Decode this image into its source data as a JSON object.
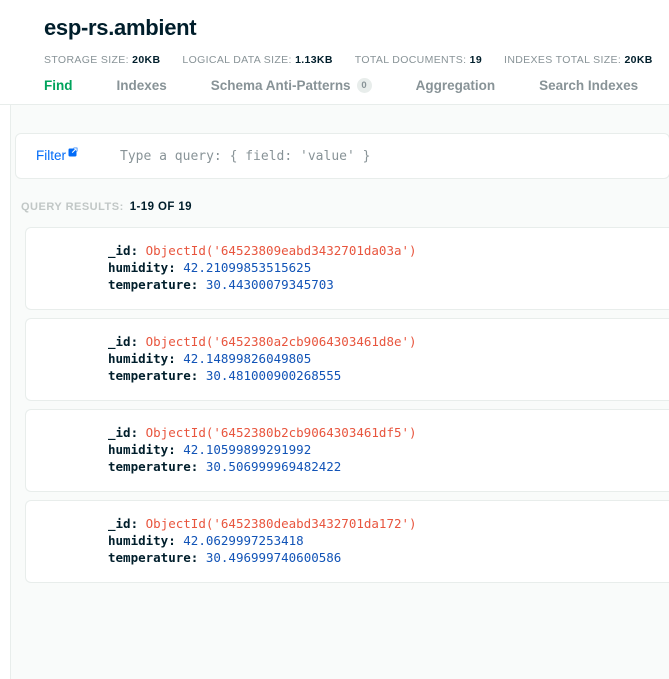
{
  "header": {
    "collection_title": "esp-rs.ambient",
    "stats": [
      {
        "label": "STORAGE SIZE:",
        "value": "20KB"
      },
      {
        "label": "LOGICAL DATA SIZE:",
        "value": "1.13KB"
      },
      {
        "label": "TOTAL DOCUMENTS:",
        "value": "19"
      },
      {
        "label": "INDEXES TOTAL SIZE:",
        "value": "20KB"
      }
    ]
  },
  "tabs": [
    {
      "label": "Find",
      "active": true,
      "badge": null
    },
    {
      "label": "Indexes",
      "active": false,
      "badge": null
    },
    {
      "label": "Schema Anti-Patterns",
      "active": false,
      "badge": "0"
    },
    {
      "label": "Aggregation",
      "active": false,
      "badge": null
    },
    {
      "label": "Search Indexes",
      "active": false,
      "badge": null
    }
  ],
  "query_bar": {
    "filter_label": "Filter",
    "filter_icon": "external-link-icon",
    "query_value": "",
    "query_placeholder": "Type a query: { field: 'value' }"
  },
  "results": {
    "label": "QUERY RESULTS:",
    "count": "1-19 OF 19"
  },
  "documents": [
    {
      "id_key": "_id",
      "id_value": "ObjectId('64523809eabd3432701da03a')",
      "humidity_key": "humidity",
      "humidity_value": "42.21099853515625",
      "temperature_key": "temperature",
      "temperature_value": "30.44300079345703"
    },
    {
      "id_key": "_id",
      "id_value": "ObjectId('6452380a2cb9064303461d8e')",
      "humidity_key": "humidity",
      "humidity_value": "42.14899826049805",
      "temperature_key": "temperature",
      "temperature_value": "30.481000900268555"
    },
    {
      "id_key": "_id",
      "id_value": "ObjectId('6452380b2cb9064303461df5')",
      "humidity_key": "humidity",
      "humidity_value": "42.10599899291992",
      "temperature_key": "temperature",
      "temperature_value": "30.506999969482422"
    },
    {
      "id_key": "_id",
      "id_value": "ObjectId('6452380deabd3432701da172')",
      "humidity_key": "humidity",
      "humidity_value": "42.0629997253418",
      "temperature_key": "temperature",
      "temperature_value": "30.496999740600586"
    }
  ],
  "colors": {
    "accent_green": "#00a35c",
    "link_blue": "#016bf8",
    "objectid_red": "#e8553e",
    "number_blue": "#1254b7",
    "text_dark": "#001e2b",
    "text_muted": "#889397",
    "surface": "#f9fbfa",
    "border": "#e8edeb"
  }
}
